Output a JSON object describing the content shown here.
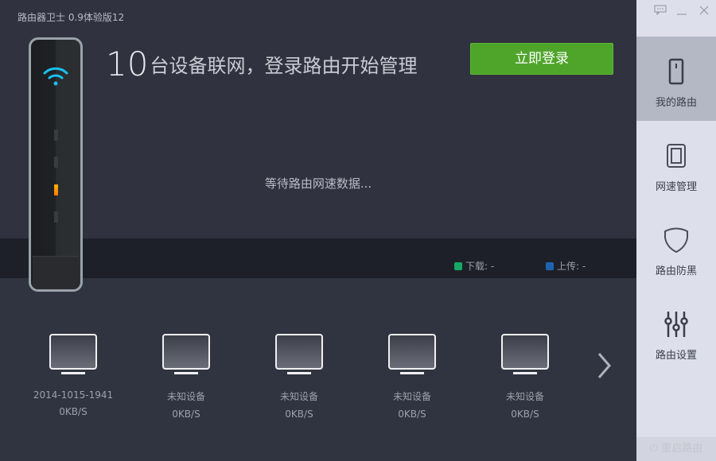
{
  "app": {
    "title": "路由器卫士 0.9体验版12"
  },
  "header": {
    "device_count": "10",
    "headline_text": "台设备联网，登录路由开始管理",
    "login_button": "立即登录"
  },
  "status": {
    "waiting_text": "等待路由网速数据..."
  },
  "legend": {
    "download_label": "下载: -",
    "upload_label": "上传: -",
    "download_color": "#16a864",
    "upload_color": "#1f63b0"
  },
  "devices": [
    {
      "name": "2014-1015-1941",
      "speed": "0KB/S"
    },
    {
      "name": "未知设备",
      "speed": "0KB/S"
    },
    {
      "name": "未知设备",
      "speed": "0KB/S"
    },
    {
      "name": "未知设备",
      "speed": "0KB/S"
    },
    {
      "name": "未知设备",
      "speed": "0KB/S"
    }
  ],
  "sidebar": {
    "items": [
      {
        "label": "我的路由",
        "icon": "router-icon",
        "active": true
      },
      {
        "label": "网速管理",
        "icon": "speed-icon"
      },
      {
        "label": "路由防黑",
        "icon": "shield-icon"
      },
      {
        "label": "路由设置",
        "icon": "sliders-icon"
      }
    ],
    "reboot_label": "重启路由"
  }
}
